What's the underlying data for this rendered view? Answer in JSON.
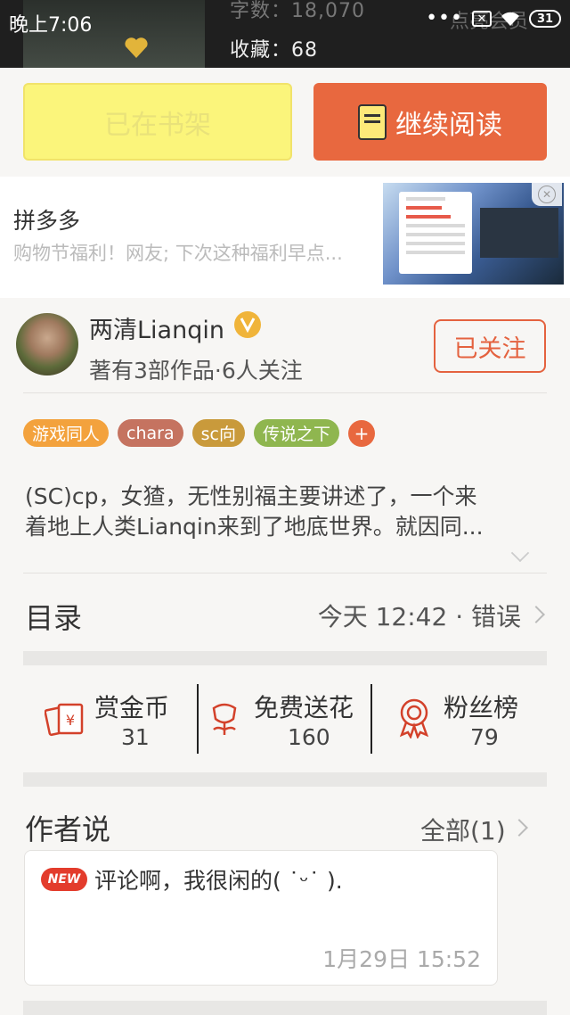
{
  "status_bar": {
    "time": "晚上7:06",
    "battery": "31",
    "overlay_text": "点亮会员"
  },
  "book": {
    "word_count": "字数：18,070",
    "collect_count": "收藏：68"
  },
  "actions": {
    "shelf_label": "已在书架",
    "read_label": "继续阅读"
  },
  "ad": {
    "title": "拼多多",
    "description": "购物节福利！网友; 下次这种福利早点..."
  },
  "author": {
    "name": "两清Lianqin",
    "meta": "著有3部作品·6人关注",
    "follow_label": "已关注"
  },
  "tags": [
    {
      "label": "游戏同人",
      "color": "#f3a23d"
    },
    {
      "label": "chara",
      "color": "#c57360"
    },
    {
      "label": "sc向",
      "color": "#c99a3b"
    },
    {
      "label": "传说之下",
      "color": "#8fb64f"
    }
  ],
  "tag_more": "+",
  "intro": {
    "line1": "(SC)cp，女猹，无性别福主要讲述了，一个来",
    "line2": "着地上人类Lianqin来到了地底世界。就因同..."
  },
  "toc": {
    "title": "目录",
    "latest": "今天 12:42 · 错误"
  },
  "stats": [
    {
      "label": "赏金币",
      "value": "31",
      "icon": "reward-coin-icon"
    },
    {
      "label": "免费送花",
      "value": "160",
      "icon": "flower-icon"
    },
    {
      "label": "粉丝榜",
      "value": "79",
      "icon": "medal-icon"
    }
  ],
  "author_said": {
    "title": "作者说",
    "all_label": "全部(1)",
    "badge": "NEW",
    "comment": "评论啊，我很闲的( ˙ᵕ˙ ).",
    "time": "1月29日  15:52"
  },
  "colors": {
    "accent": "#e8683f",
    "shelf_yellow": "#fbf57b"
  }
}
